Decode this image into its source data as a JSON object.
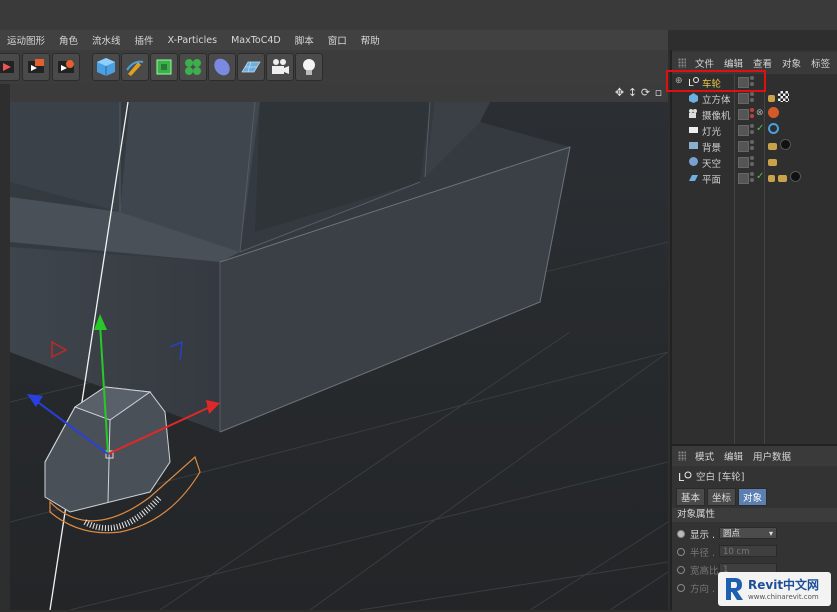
{
  "menu": [
    "运动图形",
    "角色",
    "流水线",
    "插件",
    "X-Particles",
    "MaxToC4D",
    "脚本",
    "窗口",
    "帮助"
  ],
  "toolbar": {
    "icons": [
      "render-view-icon",
      "render-settings-icon",
      "cube-icon",
      "pen-icon",
      "subdivision-icon",
      "cloner-icon",
      "deformer-icon",
      "floor-icon",
      "camera-icon",
      "light-bulb-icon"
    ]
  },
  "object_manager": {
    "tabs": [
      "文件",
      "编辑",
      "查看",
      "对象",
      "标签"
    ],
    "objects": [
      {
        "name": "车轮",
        "icon": "null-icon",
        "color": "#e8c84a",
        "tags": []
      },
      {
        "name": "立方体",
        "icon": "cube-icon",
        "color": "#d0d0d0",
        "tags": [
          "#c9a34c",
          "checker"
        ]
      },
      {
        "name": "摄像机",
        "icon": "camera-icon",
        "color": "#d0d0d0",
        "tags": [
          "#d45a2a"
        ]
      },
      {
        "name": "灯光",
        "icon": "light-icon",
        "color": "#d0d0d0",
        "tags": [
          "#4aa0e0"
        ]
      },
      {
        "name": "背景",
        "icon": "background-icon",
        "color": "#d0d0d0",
        "tags": [
          "#c9a34c",
          "#222"
        ]
      },
      {
        "name": "天空",
        "icon": "sky-icon",
        "color": "#d0d0d0",
        "tags": [
          "#c9a34c"
        ]
      },
      {
        "name": "平面",
        "icon": "plane-icon",
        "color": "#d0d0d0",
        "tags": [
          "#c9a34c",
          "#c9a34c",
          "#222"
        ]
      }
    ]
  },
  "attributes": {
    "tabs": [
      "模式",
      "编辑",
      "用户数据"
    ],
    "title": "空白 [车轮]",
    "subtabs": [
      "基本",
      "坐标",
      "对象"
    ],
    "active_subtab": 2,
    "section": "对象属性",
    "props": [
      {
        "label": "显示 .",
        "value": "圆点",
        "active": true
      },
      {
        "label": "半径 .",
        "value": "10 cm",
        "active": false
      },
      {
        "label": "宽高比",
        "value": "1",
        "active": false
      },
      {
        "label": "方向 .",
        "value": "",
        "active": false
      }
    ]
  },
  "watermark": {
    "brand": "Revit中文网",
    "url": "www.chinarevit.com"
  }
}
